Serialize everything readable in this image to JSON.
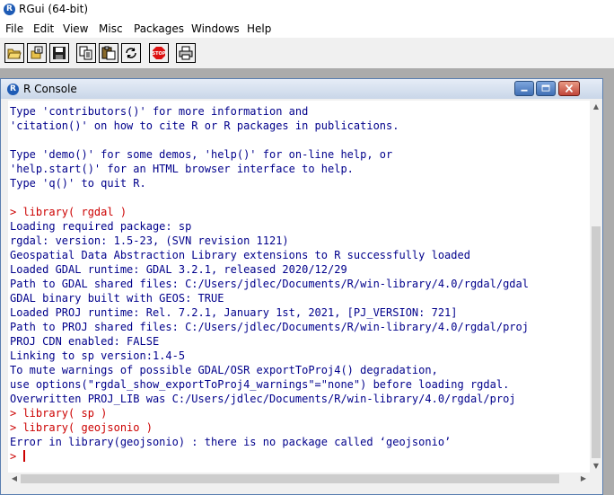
{
  "app": {
    "icon_letter": "R",
    "title": "RGui (64-bit)"
  },
  "menu": [
    "File",
    "Edit",
    "View",
    "Misc",
    "Packages",
    "Windows",
    "Help"
  ],
  "toolbar": [
    {
      "name": "open-script-button",
      "icon": "folder-open-icon"
    },
    {
      "name": "load-workspace-button",
      "icon": "load-workspace-icon"
    },
    {
      "name": "save-workspace-button",
      "icon": "floppy-disk-icon"
    },
    {
      "name": "copy-button",
      "icon": "copy-icon"
    },
    {
      "name": "paste-button",
      "icon": "paste-icon"
    },
    {
      "name": "copy-paste-button",
      "icon": "refresh-icon"
    },
    {
      "name": "stop-button",
      "icon": "stop-sign-icon",
      "label": "STOP"
    },
    {
      "name": "print-button",
      "icon": "printer-icon"
    }
  ],
  "console": {
    "title": "R Console",
    "lines": [
      {
        "type": "out",
        "text": "Type 'contributors()' for more information and"
      },
      {
        "type": "out",
        "text": "'citation()' on how to cite R or R packages in publications."
      },
      {
        "type": "out",
        "text": ""
      },
      {
        "type": "out",
        "text": "Type 'demo()' for some demos, 'help()' for on-line help, or"
      },
      {
        "type": "out",
        "text": "'help.start()' for an HTML browser interface to help."
      },
      {
        "type": "out",
        "text": "Type 'q()' to quit R."
      },
      {
        "type": "out",
        "text": ""
      },
      {
        "type": "cmd",
        "text": "> library( rgdal )"
      },
      {
        "type": "out",
        "text": "Loading required package: sp"
      },
      {
        "type": "out",
        "text": "rgdal: version: 1.5-23, (SVN revision 1121)"
      },
      {
        "type": "out",
        "text": "Geospatial Data Abstraction Library extensions to R successfully loaded"
      },
      {
        "type": "out",
        "text": "Loaded GDAL runtime: GDAL 3.2.1, released 2020/12/29"
      },
      {
        "type": "out",
        "text": "Path to GDAL shared files: C:/Users/jdlec/Documents/R/win-library/4.0/rgdal/gdal"
      },
      {
        "type": "out",
        "text": "GDAL binary built with GEOS: TRUE"
      },
      {
        "type": "out",
        "text": "Loaded PROJ runtime: Rel. 7.2.1, January 1st, 2021, [PJ_VERSION: 721]"
      },
      {
        "type": "out",
        "text": "Path to PROJ shared files: C:/Users/jdlec/Documents/R/win-library/4.0/rgdal/proj"
      },
      {
        "type": "out",
        "text": "PROJ CDN enabled: FALSE"
      },
      {
        "type": "out",
        "text": "Linking to sp version:1.4-5"
      },
      {
        "type": "out",
        "text": "To mute warnings of possible GDAL/OSR exportToProj4() degradation,"
      },
      {
        "type": "out",
        "text": "use options(\"rgdal_show_exportToProj4_warnings\"=\"none\") before loading rgdal."
      },
      {
        "type": "out",
        "text": "Overwritten PROJ_LIB was C:/Users/jdlec/Documents/R/win-library/4.0/rgdal/proj"
      },
      {
        "type": "cmd",
        "text": "> library( sp )"
      },
      {
        "type": "cmd",
        "text": "> library( geojsonio )"
      },
      {
        "type": "out",
        "text": "Error in library(geojsonio) : there is no package called ‘geojsonio’"
      }
    ],
    "prompt": ">"
  },
  "colors": {
    "output": "#00008b",
    "command": "#cc0000"
  }
}
